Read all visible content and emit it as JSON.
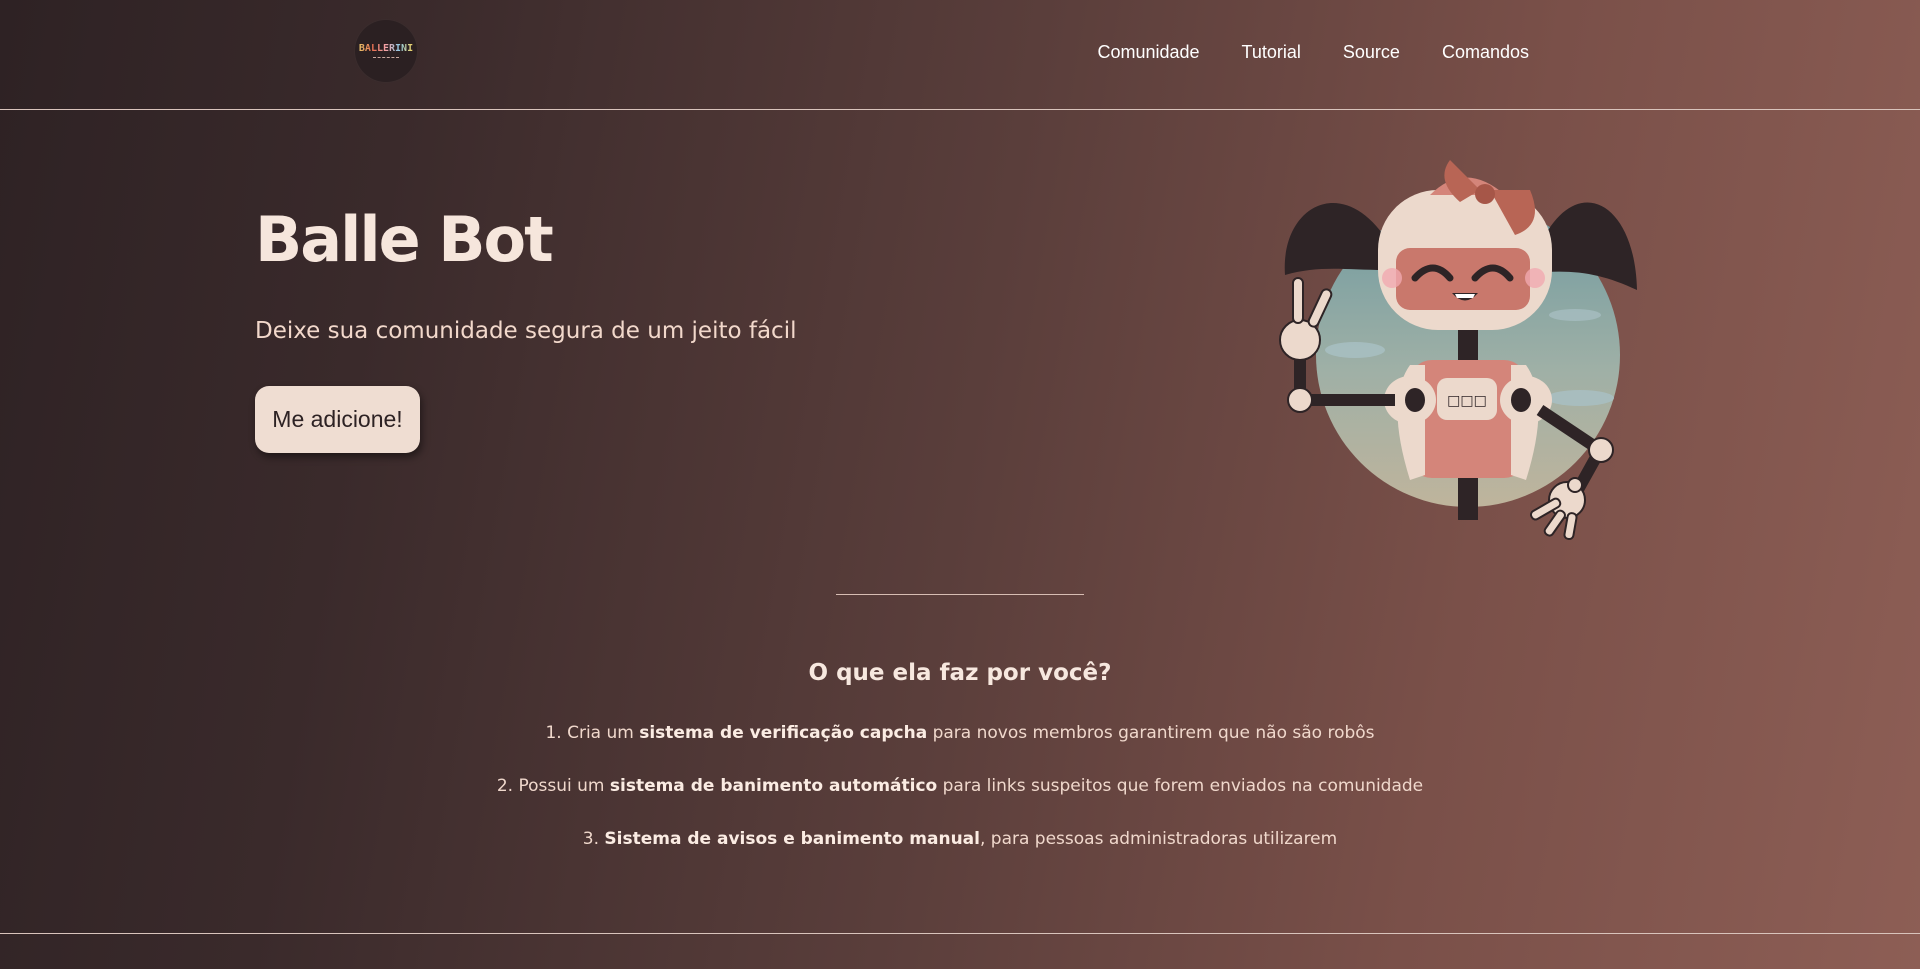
{
  "header": {
    "logo_text": "BALLERINI",
    "nav": [
      "Comunidade",
      "Tutorial",
      "Source",
      "Comandos"
    ]
  },
  "hero": {
    "title": "Balle Bot",
    "subtitle": "Deixe sua comunidade segura de um jeito fácil",
    "cta_label": "Me adicione!",
    "robot_chest_text": "□□□"
  },
  "features": {
    "title": "O que ela faz por você?",
    "items": [
      {
        "prefix": "1. Cria um ",
        "bold": "sistema de verificação capcha",
        "suffix": " para novos membros garantirem que não são robôs"
      },
      {
        "prefix": "2. Possui um ",
        "bold": "sistema de banimento automático",
        "suffix": " para links suspeitos que forem enviados na comunidade"
      },
      {
        "prefix": "3. ",
        "bold": "Sistema de avisos e banimento manual",
        "suffix": ", para pessoas administradoras utilizarem"
      }
    ]
  },
  "colors": {
    "accent_button": "#efddd2",
    "robot_pink": "#d4857a",
    "robot_cream": "#ecd9cc",
    "hair": "#2e2426"
  },
  "icons": [
    "ballerini-logo",
    "robot-illustration"
  ]
}
